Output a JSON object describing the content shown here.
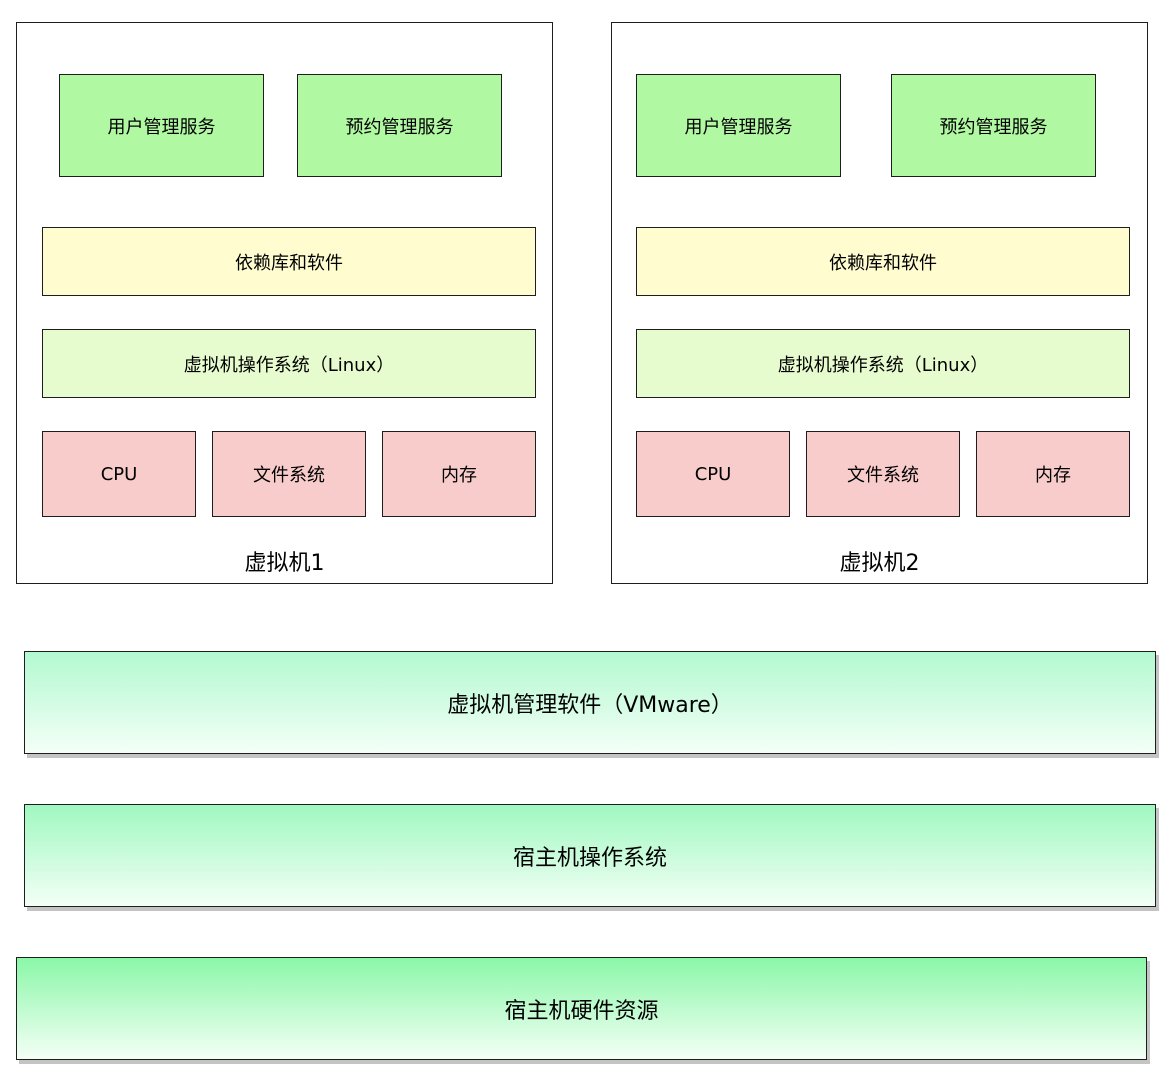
{
  "virtual_machines": [
    {
      "label": "虚拟机1",
      "services": [
        "用户管理服务",
        "预约管理服务"
      ],
      "dependencies": "依赖库和软件",
      "guest_os": "虚拟机操作系统（Linux）",
      "resources": [
        "CPU",
        "文件系统",
        "内存"
      ]
    },
    {
      "label": "虚拟机2",
      "services": [
        "用户管理服务",
        "预约管理服务"
      ],
      "dependencies": "依赖库和软件",
      "guest_os": "虚拟机操作系统（Linux）",
      "resources": [
        "CPU",
        "文件系统",
        "内存"
      ]
    }
  ],
  "layers": {
    "hypervisor": "虚拟机管理软件（VMware）",
    "host_os": "宿主机操作系统",
    "host_hardware": "宿主机硬件资源"
  },
  "colors": {
    "service": "#b0f9a2",
    "dependency": "#fffdd0",
    "guest_os": "#e7fcce",
    "resource": "#f7cccb",
    "layer_gradient_top": "#8af7a8",
    "layer_gradient_bottom": "#f4fff6"
  }
}
